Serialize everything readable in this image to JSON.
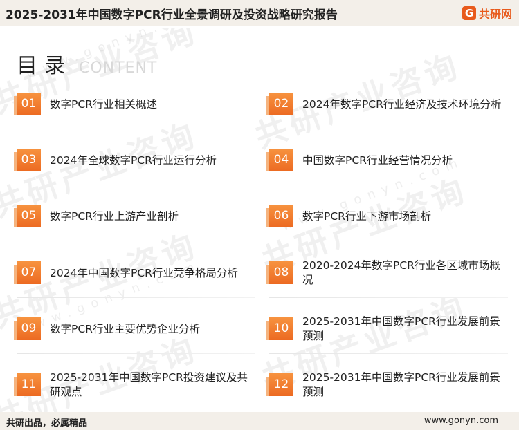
{
  "header": {
    "title": "2025-2031年中国数字PCR行业全景调研及投资战略研究报告",
    "brand_logo_char": "G",
    "brand_name": "共研网"
  },
  "heading": {
    "main": "目录",
    "sub": "CONTENT"
  },
  "watermark": {
    "text": "共研产业咨询",
    "url": "www.gonyn.com"
  },
  "items": [
    {
      "num": "01",
      "label": "数字PCR行业相关概述"
    },
    {
      "num": "02",
      "label": "2024年数字PCR行业经济及技术环境分析"
    },
    {
      "num": "03",
      "label": "2024年全球数字PCR行业运行分析"
    },
    {
      "num": "04",
      "label": "中国数字PCR行业经营情况分析"
    },
    {
      "num": "05",
      "label": "数字PCR行业上游产业剖析"
    },
    {
      "num": "06",
      "label": "数字PCR行业下游市场剖析"
    },
    {
      "num": "07",
      "label": "2024年中国数字PCR行业竞争格局分析"
    },
    {
      "num": "08",
      "label": "2020-2024年数字PCR行业各区域市场概况"
    },
    {
      "num": "09",
      "label": "数字PCR行业主要优势企业分析"
    },
    {
      "num": "10",
      "label": "2025-2031年中国数字PCR行业发展前景预测"
    },
    {
      "num": "11",
      "label": "2025-2031年中国数字PCR投资建议及共研观点"
    },
    {
      "num": "12",
      "label": "2025-2031年中国数字PCR行业发展前景预测"
    }
  ],
  "footer": {
    "slogan": "共研出品，必属精品",
    "site": "www.gonyn.com"
  },
  "colors": {
    "accent": "#ec6a22",
    "band": "#f3efe9"
  }
}
